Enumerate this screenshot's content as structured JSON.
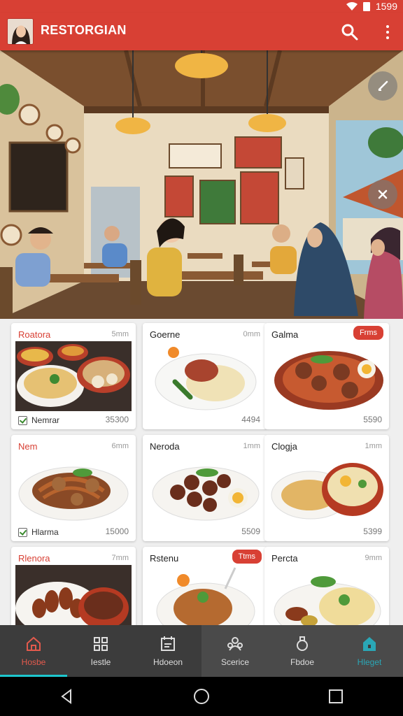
{
  "status_bar": {
    "time": "1599",
    "color": "#d84034"
  },
  "app_bar": {
    "title": "RESTORGIAN",
    "search_icon": "search-icon",
    "menu_icon": "more-vertical-icon"
  },
  "hero": {
    "fab_edit_icon": "pencil-icon",
    "fab_close_icon": "close-icon"
  },
  "cards": [
    {
      "name": "Roatora",
      "time": "5mm",
      "badge": "",
      "bottom_label": "Nemrar",
      "check": true,
      "price": "35300"
    },
    {
      "name": "Goerne",
      "time": "0mm",
      "badge": "",
      "bottom_label": "",
      "check": false,
      "price": "4494"
    },
    {
      "name": "Galma",
      "time": "",
      "badge": "Frms",
      "bottom_label": "",
      "check": false,
      "price": "5590"
    },
    {
      "name": "Nem",
      "time": "6mm",
      "badge": "",
      "bottom_label": "Hlarma",
      "check": true,
      "price": "15000"
    },
    {
      "name": "Neroda",
      "time": "1mm",
      "badge": "",
      "bottom_label": "",
      "check": false,
      "price": "5509"
    },
    {
      "name": "Clogja",
      "time": "1mm",
      "badge": "",
      "bottom_label": "",
      "check": false,
      "price": "5399"
    },
    {
      "name": "Rlenora",
      "time": "7mm",
      "badge": "",
      "bottom_label": "",
      "check": false,
      "price": ""
    },
    {
      "name": "Rstenu",
      "time": "",
      "badge": "Ttms",
      "bottom_label": "",
      "check": false,
      "price": ""
    },
    {
      "name": "Percta",
      "time": "9mm",
      "badge": "",
      "bottom_label": "",
      "check": false,
      "price": ""
    }
  ],
  "bottom_nav": [
    {
      "label": "Hosbe",
      "icon": "home-icon"
    },
    {
      "label": "Iestle",
      "icon": "grid-icon"
    },
    {
      "label": "Hdoeon",
      "icon": "calendar-icon"
    },
    {
      "label": "Scerice",
      "icon": "people-icon"
    },
    {
      "label": "Fbdoe",
      "icon": "bell-icon"
    },
    {
      "label": "Hleget",
      "icon": "house-icon"
    }
  ],
  "system_nav": {
    "back": "back-icon",
    "home": "home-circle-icon",
    "recents": "recents-icon"
  },
  "colors": {
    "primary": "#d84034",
    "accent": "#1ec7ce",
    "nav_bg": "#3c3c3c"
  }
}
